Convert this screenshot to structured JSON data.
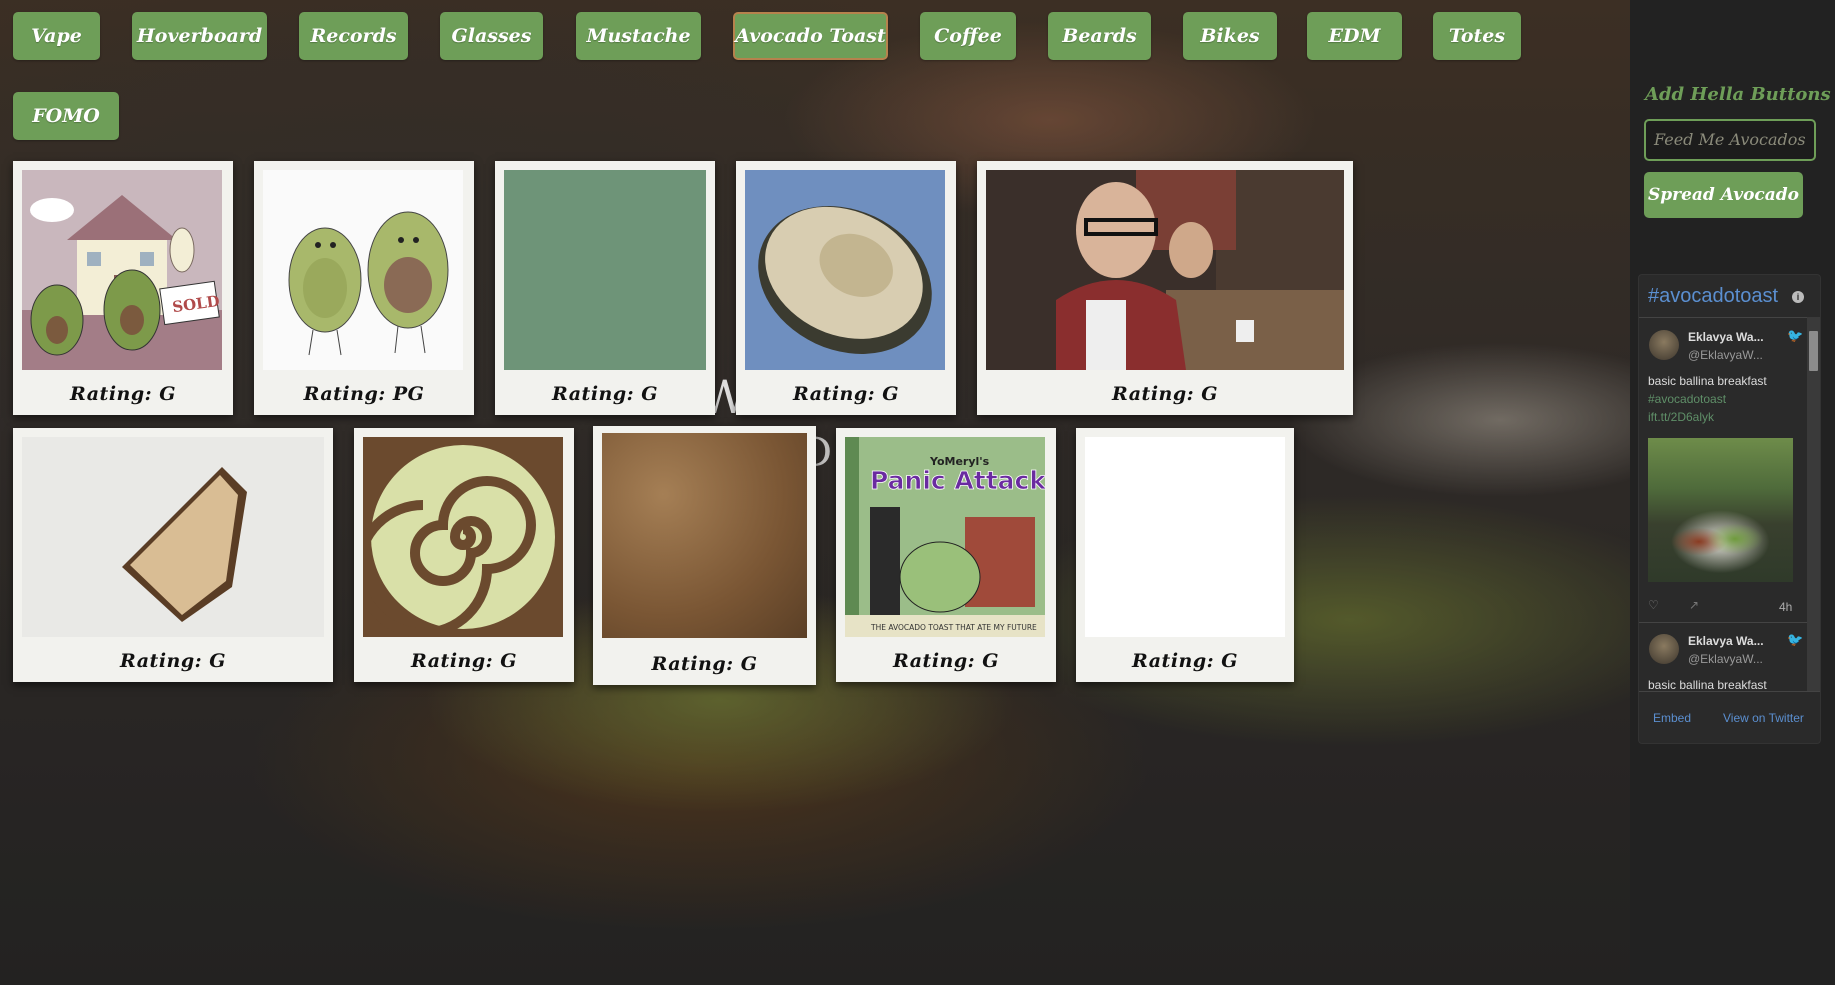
{
  "nav": {
    "buttons": [
      {
        "label": "Vape"
      },
      {
        "label": "Hoverboard"
      },
      {
        "label": "Records"
      },
      {
        "label": "Glasses"
      },
      {
        "label": "Mustache"
      },
      {
        "label": "Avocado Toast",
        "active": true
      },
      {
        "label": "Coffee"
      },
      {
        "label": "Beards"
      },
      {
        "label": "Bikes"
      },
      {
        "label": "EDM"
      },
      {
        "label": "Totes"
      },
      {
        "label": "FOMO"
      }
    ]
  },
  "cards": [
    {
      "rating": "Rating: G",
      "image": "house-sold-avocados-illustration"
    },
    {
      "rating": "Rating: PG",
      "image": "two-avocados-illustration"
    },
    {
      "rating": "Rating: G",
      "image": "green-placeholder"
    },
    {
      "rating": "Rating: G",
      "image": "avocado-half-photo"
    },
    {
      "rating": "Rating: G",
      "image": "guys-eating-photo"
    },
    {
      "rating": "Rating: G",
      "image": "toast-slice-photo"
    },
    {
      "rating": "Rating: G",
      "image": "avocado-spiral"
    },
    {
      "rating": "Rating: G",
      "image": "toast-texture"
    },
    {
      "rating": "Rating: G",
      "image": "panic-attacks-book-cover",
      "book_title": "Panic Attacks",
      "book_author": "YoMeryl's",
      "book_tagline": "THE AVOCADO TOAST THAT ATE MY FUTURE"
    },
    {
      "rating": "Rating: G",
      "image": "blank-white"
    }
  ],
  "sidebar": {
    "title": "Add Hella Buttons",
    "input_placeholder": "Feed Me Avocados",
    "button_label": "Spread Avocado"
  },
  "twitter": {
    "header": "#avocadotoast",
    "tweets": [
      {
        "name": "Eklavya Wa...",
        "handle": "@EklavyaW...",
        "text": "basic ballina breakfast",
        "hashtag": "#avocadotoast",
        "link": "ift.tt/2D6alyk",
        "time": "4h"
      },
      {
        "name": "Eklavya Wa...",
        "handle": "@EklavyaW...",
        "text": "basic ballina breakfast"
      }
    ],
    "embed_label": "Embed",
    "view_label": "View on Twitter"
  },
  "colors": {
    "button_green": "#6e9e58",
    "active_border": "#b6824d",
    "sidebar_bg": "#222222",
    "twitter_link": "#5b8fd0"
  }
}
